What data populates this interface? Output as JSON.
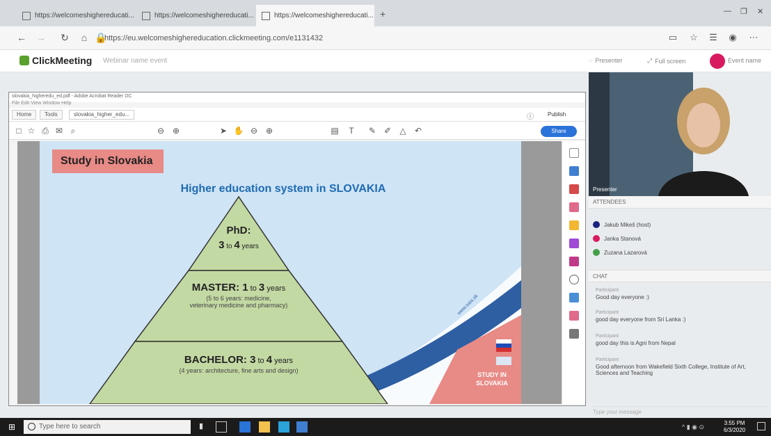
{
  "browser": {
    "tabs": [
      {
        "label": "https://welcomeshighereducati..."
      },
      {
        "label": "https://welcomeshighereducati..."
      },
      {
        "label": "https://welcomeshighereducati..."
      }
    ],
    "url": "https://eu.welcomeshighereducation.clickmeeting.com/e1131432",
    "window_controls": [
      "—",
      "❐",
      "✕"
    ]
  },
  "clickmeeting": {
    "brand": "ClickMeeting",
    "event_title": "Webinar name event",
    "header_items": [
      "Presenter",
      "Full screen",
      "Event name"
    ]
  },
  "viewer": {
    "window_title": "slovakia_higheredu_ed.pdf - Adobe Acrobat Reader DC",
    "menu": "File  Edit  View  Window  Help",
    "tabs": [
      "Home",
      "Tools",
      "slovakia_higher_edu..."
    ],
    "publish": "Publish",
    "share": "Share"
  },
  "slide": {
    "banner": "Study in Slovakia",
    "title": "Higher education system in SLOVAKIA",
    "phd": {
      "head": "PhD:",
      "sub_a": "3",
      "sub_b": "to",
      "sub_c": "4",
      "sub_d": "years"
    },
    "master": {
      "head_a": "MASTER: 1",
      "head_b": "to",
      "head_c": "3",
      "head_d": "years",
      "note1": "(5 to 6 years: medicine,",
      "note2": "veterinary medicine and pharmacy)"
    },
    "bachelor": {
      "head_a": "BACHELOR: 3",
      "head_b": "to",
      "head_c": "4",
      "head_d": "years",
      "note": "(4 years: architecture, fine arts and design)"
    },
    "corner_label": "STUDY IN SLOVAKIA",
    "wave_text": "www.saia.sk"
  },
  "video": {
    "name": "Presenter"
  },
  "attendees": {
    "header": "ATTENDEES",
    "list": [
      {
        "name": "Jakub Mikeš (host)",
        "color": "#1a237e"
      },
      {
        "name": "Janka Stanová",
        "color": "#d81b60"
      },
      {
        "name": "Zuzana Lazarová",
        "color": "#43a047"
      }
    ]
  },
  "chat": {
    "header": "CHAT",
    "messages": [
      {
        "who": "Participant",
        "text": "Good day everyone :)"
      },
      {
        "who": "Participant",
        "text": "good day everyone from Sri Lanka :)"
      },
      {
        "who": "Participant",
        "text": "good day this is Agni from Nepal"
      },
      {
        "who": "Participant",
        "text": "Good afternoon from Wakefield Sixth College, Institute of Art, Sciences and Teaching"
      }
    ],
    "input_placeholder": "Type your message"
  },
  "taskbar": {
    "search": "Type here to search",
    "time": "3:55 PM",
    "date": "6/3/2020"
  },
  "colors": {
    "slide_bg": "#cfe4f5",
    "pyramid_fill": "#c3d9a3",
    "banner": "#e88a86",
    "title_blue": "#1f6bb3",
    "wave_blue": "#2e5fa3"
  }
}
